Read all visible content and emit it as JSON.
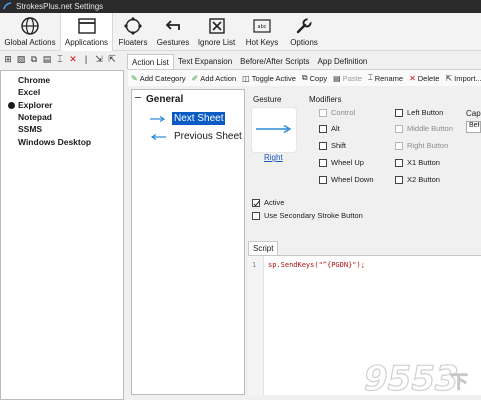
{
  "window": {
    "title": "StrokesPlus.net Settings"
  },
  "main_toolbar": {
    "items": [
      {
        "label": "Global Actions",
        "icon": "globe-icon"
      },
      {
        "label": "Applications",
        "icon": "window-icon",
        "active": true
      },
      {
        "label": "Floaters",
        "icon": "floater-icon"
      },
      {
        "label": "Gestures",
        "icon": "gesture-arrow-icon"
      },
      {
        "label": "Ignore List",
        "icon": "ignore-icon"
      },
      {
        "label": "Hot Keys",
        "icon": "keyboard-icon"
      },
      {
        "label": "Options",
        "icon": "wrench-icon"
      }
    ]
  },
  "apps": {
    "items": [
      {
        "label": "Chrome"
      },
      {
        "label": "Excel"
      },
      {
        "label": "Explorer"
      },
      {
        "label": "Notepad"
      },
      {
        "label": "SSMS"
      },
      {
        "label": "Windows Desktop"
      }
    ]
  },
  "tabs": [
    "Action List",
    "Text Expansion",
    "Before/After Scripts",
    "App Definition"
  ],
  "action_toolbar": {
    "add_category": "Add Category",
    "add_action": "Add Action",
    "toggle_active": "Toggle Active",
    "copy": "Copy",
    "paste": "Paste",
    "rename": "Rename",
    "delete": "Delete",
    "import": "Import..."
  },
  "tree": {
    "category": "General",
    "actions": [
      {
        "name": "Next Sheet",
        "selected": true
      },
      {
        "name": "Previous Sheet",
        "selected": false
      }
    ]
  },
  "details": {
    "gesture_label": "Gesture",
    "gesture_name": "Right",
    "modifiers_label": "Modifiers",
    "capture_label": "Cap",
    "capture_value": "Befo",
    "modifiers": {
      "control": "Control",
      "alt": "Alt",
      "shift": "Shift",
      "wheel_up": "Wheel Up",
      "wheel_down": "Wheel Down",
      "left_button": "Left Button",
      "middle_button": "Middle Button",
      "right_button": "Right Button",
      "x1_button": "X1 Button",
      "x2_button": "X2 Button"
    },
    "active_label": "Active",
    "active_checked": true,
    "secondary_label": "Use Secondary Stroke Button",
    "secondary_checked": false
  },
  "script": {
    "tab_label": "Script",
    "line_number": "1",
    "code": "sp.SendKeys(\"^{PGDN}\");"
  }
}
